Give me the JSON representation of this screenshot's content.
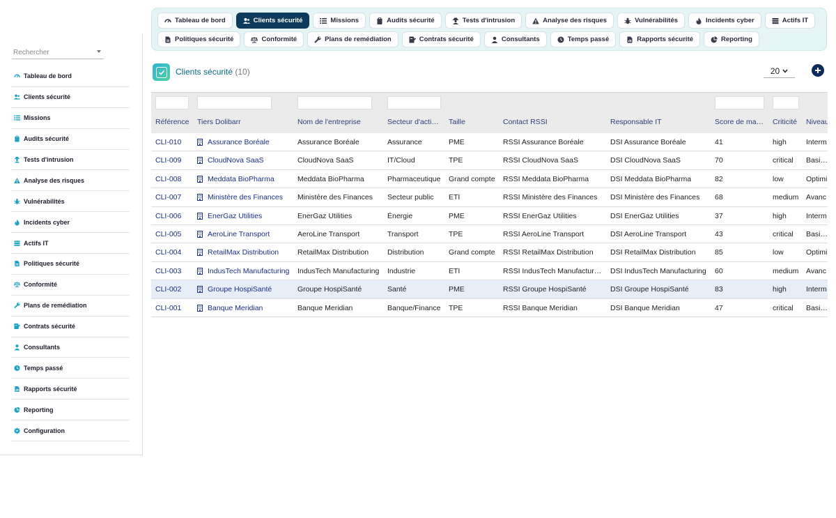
{
  "sidebar": {
    "search_placeholder": "Rechercher",
    "items": [
      {
        "label": "Tableau de bord",
        "icon": "gauge-icon"
      },
      {
        "label": "Clients sécurité",
        "icon": "users-icon"
      },
      {
        "label": "Missions",
        "icon": "list-icon"
      },
      {
        "label": "Audits sécurité",
        "icon": "clipboard-icon"
      },
      {
        "label": "Tests d'intrusion",
        "icon": "user-secret-icon"
      },
      {
        "label": "Analyse des risques",
        "icon": "warning-icon"
      },
      {
        "label": "Vulnérabilités",
        "icon": "bug-icon"
      },
      {
        "label": "Incidents cyber",
        "icon": "fire-icon"
      },
      {
        "label": "Actifs IT",
        "icon": "server-icon"
      },
      {
        "label": "Politiques sécurité",
        "icon": "file-icon"
      },
      {
        "label": "Conformité",
        "icon": "balance-icon"
      },
      {
        "label": "Plans de remédiation",
        "icon": "wrench-icon"
      },
      {
        "label": "Contrats sécurité",
        "icon": "contract-icon"
      },
      {
        "label": "Consultants",
        "icon": "user-icon"
      },
      {
        "label": "Temps passé",
        "icon": "clock-icon"
      },
      {
        "label": "Rapports sécurité",
        "icon": "report-icon"
      },
      {
        "label": "Reporting",
        "icon": "pie-icon"
      },
      {
        "label": "Configuration",
        "icon": "gear-icon"
      }
    ]
  },
  "tabs": {
    "row1": [
      {
        "label": "Tableau de bord",
        "icon": "gauge-icon",
        "active": false
      },
      {
        "label": "Clients sécurité",
        "icon": "users-icon",
        "active": true
      },
      {
        "label": "Missions",
        "icon": "list-icon",
        "active": false
      },
      {
        "label": "Audits sécurité",
        "icon": "clipboard-icon",
        "active": false
      },
      {
        "label": "Tests d'intrusion",
        "icon": "user-secret-icon",
        "active": false
      },
      {
        "label": "Analyse des risques",
        "icon": "warning-icon",
        "active": false
      },
      {
        "label": "Vulnérabilités",
        "icon": "bug-icon",
        "active": false
      },
      {
        "label": "Incidents cyber",
        "icon": "fire-icon",
        "active": false
      },
      {
        "label": "Actifs IT",
        "icon": "server-icon",
        "active": false
      }
    ],
    "row2": [
      {
        "label": "Politiques sécurité",
        "icon": "file-icon",
        "active": false
      },
      {
        "label": "Conformité",
        "icon": "balance-icon",
        "active": false
      },
      {
        "label": "Plans de remédiation",
        "icon": "wrench-icon",
        "active": false
      },
      {
        "label": "Contrats sécurité",
        "icon": "contract-icon",
        "active": false
      },
      {
        "label": "Consultants",
        "icon": "user-icon",
        "active": false
      },
      {
        "label": "Temps passé",
        "icon": "clock-icon",
        "active": false
      },
      {
        "label": "Rapports sécurité",
        "icon": "report-icon",
        "active": false
      },
      {
        "label": "Reporting",
        "icon": "pie-icon",
        "active": false
      }
    ]
  },
  "page": {
    "title": "Clients sécurité",
    "count": "(10)",
    "per_page": "20",
    "add_icon": "plus-circle-icon"
  },
  "table": {
    "columns": [
      "Référence",
      "Tiers Dolibarr",
      "Nom de l'entreprise",
      "Secteur d'acti…",
      "Taille",
      "Contact RSSI",
      "Responsable IT",
      "Score de ma…",
      "Criticité",
      "Niveau"
    ],
    "rows": [
      [
        "CLI-010",
        "Assurance Boréale",
        "Assurance Boréale",
        "Assurance",
        "PME",
        "RSSI Assurance Boréale",
        "DSI Assurance Boréale",
        "41",
        "high",
        "Interm"
      ],
      [
        "CLI-009",
        "CloudNova SaaS",
        "CloudNova SaaS",
        "IT/Cloud",
        "TPE",
        "RSSI CloudNova SaaS",
        "DSI CloudNova SaaS",
        "70",
        "critical",
        "Basiqu"
      ],
      [
        "CLI-008",
        "Meddata BioPharma",
        "Meddata BioPharma",
        "Pharmaceutique",
        "Grand compte",
        "RSSI Meddata BioPharma",
        "DSI Meddata BioPharma",
        "82",
        "low",
        "Optimi"
      ],
      [
        "CLI-007",
        "Ministère des Finances",
        "Ministère des Finances",
        "Secteur public",
        "ETI",
        "RSSI Ministère des Finances",
        "DSI Ministère des Finances",
        "68",
        "medium",
        "Avanc"
      ],
      [
        "CLI-006",
        "EnerGaz Utilities",
        "EnerGaz Utilities",
        "Énergie",
        "PME",
        "RSSI EnerGaz Utilities",
        "DSI EnerGaz Utilities",
        "37",
        "high",
        "Interm"
      ],
      [
        "CLI-005",
        "AeroLine Transport",
        "AeroLine Transport",
        "Transport",
        "TPE",
        "RSSI AeroLine Transport",
        "DSI AeroLine Transport",
        "43",
        "critical",
        "Basiqu"
      ],
      [
        "CLI-004",
        "RetailMax Distribution",
        "RetailMax Distribution",
        "Distribution",
        "Grand compte",
        "RSSI RetailMax Distribution",
        "DSI RetailMax Distribution",
        "85",
        "low",
        "Optimi"
      ],
      [
        "CLI-003",
        "IndusTech Manufacturing",
        "IndusTech Manufacturing",
        "Industrie",
        "ETI",
        "RSSI IndusTech Manufactur…",
        "DSI IndusTech Manufacturing",
        "60",
        "medium",
        "Avanc"
      ],
      [
        "CLI-002",
        "Groupe HospiSanté",
        "Groupe HospiSanté",
        "Santé",
        "PME",
        "RSSI Groupe HospiSanté",
        "DSI Groupe HospiSanté",
        "83",
        "high",
        "Interm"
      ],
      [
        "CLI-001",
        "Banque Meridian",
        "Banque Meridian",
        "Banque/Finance",
        "TPE",
        "RSSI Banque Meridian",
        "DSI Banque Meridian",
        "47",
        "critical",
        "Basiqu"
      ]
    ],
    "highlighted_row": 8
  },
  "colors": {
    "accent": "#0e3a5c",
    "sidebar_icon": "#1fa3c4",
    "link": "#1a2f86",
    "topbar_bg": "#e5f5f6"
  }
}
